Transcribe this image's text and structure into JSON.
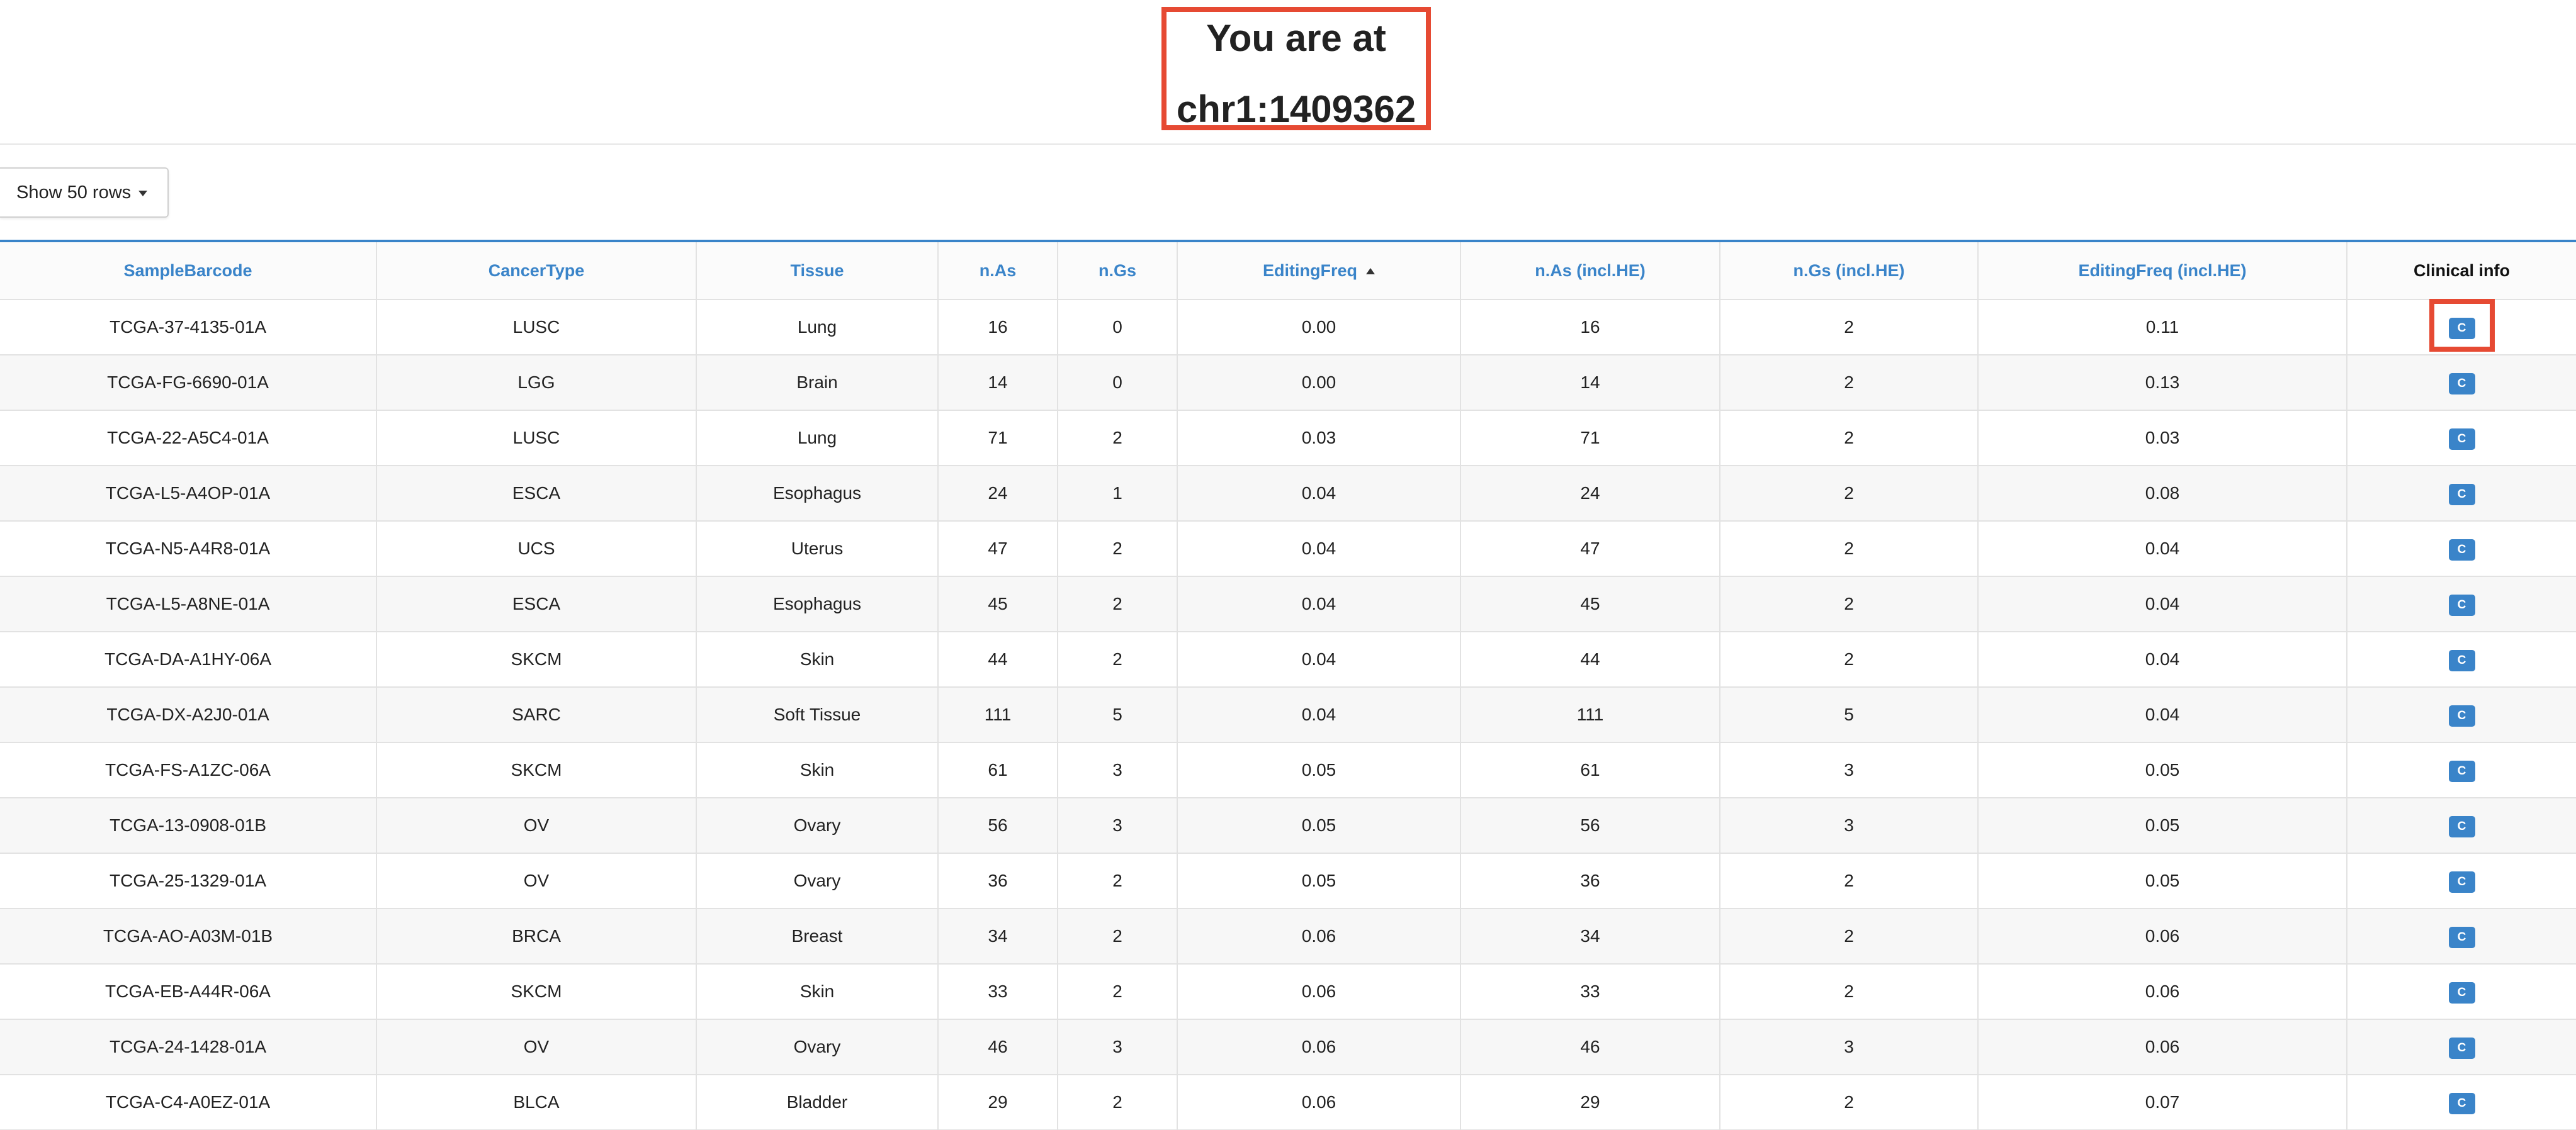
{
  "header": {
    "line1": "You are at",
    "line2": "chr1:1409362"
  },
  "controls": {
    "rows_button_label": "Show 50 rows"
  },
  "table": {
    "columns": [
      "SampleBarcode",
      "CancerType",
      "Tissue",
      "n.As",
      "n.Gs",
      "EditingFreq",
      "n.As (incl.HE)",
      "n.Gs (incl.HE)",
      "EditingFreq (incl.HE)",
      "Clinical info"
    ],
    "sorted_column": "EditingFreq",
    "sort_direction": "ascending",
    "clinical_button_label": "C",
    "rows": [
      [
        "TCGA-37-4135-01A",
        "LUSC",
        "Lung",
        "16",
        "0",
        "0.00",
        "16",
        "2",
        "0.11"
      ],
      [
        "TCGA-FG-6690-01A",
        "LGG",
        "Brain",
        "14",
        "0",
        "0.00",
        "14",
        "2",
        "0.13"
      ],
      [
        "TCGA-22-A5C4-01A",
        "LUSC",
        "Lung",
        "71",
        "2",
        "0.03",
        "71",
        "2",
        "0.03"
      ],
      [
        "TCGA-L5-A4OP-01A",
        "ESCA",
        "Esophagus",
        "24",
        "1",
        "0.04",
        "24",
        "2",
        "0.08"
      ],
      [
        "TCGA-N5-A4R8-01A",
        "UCS",
        "Uterus",
        "47",
        "2",
        "0.04",
        "47",
        "2",
        "0.04"
      ],
      [
        "TCGA-L5-A8NE-01A",
        "ESCA",
        "Esophagus",
        "45",
        "2",
        "0.04",
        "45",
        "2",
        "0.04"
      ],
      [
        "TCGA-DA-A1HY-06A",
        "SKCM",
        "Skin",
        "44",
        "2",
        "0.04",
        "44",
        "2",
        "0.04"
      ],
      [
        "TCGA-DX-A2J0-01A",
        "SARC",
        "Soft Tissue",
        "111",
        "5",
        "0.04",
        "111",
        "5",
        "0.04"
      ],
      [
        "TCGA-FS-A1ZC-06A",
        "SKCM",
        "Skin",
        "61",
        "3",
        "0.05",
        "61",
        "3",
        "0.05"
      ],
      [
        "TCGA-13-0908-01B",
        "OV",
        "Ovary",
        "56",
        "3",
        "0.05",
        "56",
        "3",
        "0.05"
      ],
      [
        "TCGA-25-1329-01A",
        "OV",
        "Ovary",
        "36",
        "2",
        "0.05",
        "36",
        "2",
        "0.05"
      ],
      [
        "TCGA-AO-A03M-01B",
        "BRCA",
        "Breast",
        "34",
        "2",
        "0.06",
        "34",
        "2",
        "0.06"
      ],
      [
        "TCGA-EB-A44R-06A",
        "SKCM",
        "Skin",
        "33",
        "2",
        "0.06",
        "33",
        "2",
        "0.06"
      ],
      [
        "TCGA-24-1428-01A",
        "OV",
        "Ovary",
        "46",
        "3",
        "0.06",
        "46",
        "3",
        "0.06"
      ],
      [
        "TCGA-C4-A0EZ-01A",
        "BLCA",
        "Bladder",
        "29",
        "2",
        "0.06",
        "29",
        "2",
        "0.07"
      ]
    ]
  },
  "colors": {
    "accent": "#3a84c9",
    "highlight": "#e64a33"
  }
}
